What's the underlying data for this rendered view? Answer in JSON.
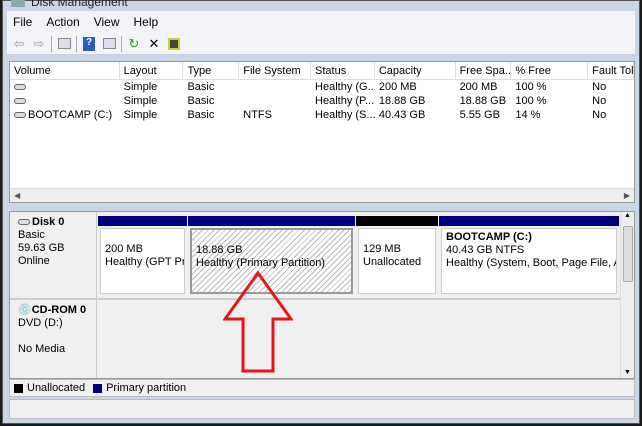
{
  "window": {
    "title": "Disk Management"
  },
  "menu": [
    "File",
    "Action",
    "View",
    "Help"
  ],
  "toolbar": [
    "back-icon",
    "forward-icon",
    "console-tree-icon",
    "help-icon",
    "action-pane-icon",
    "refresh-icon",
    "delete-icon",
    "properties-icon"
  ],
  "volumes": {
    "columns": [
      "Volume",
      "Layout",
      "Type",
      "File System",
      "Status",
      "Capacity",
      "Free Spa...",
      "% Free",
      "Fault Tole"
    ],
    "rows": [
      [
        "",
        "Simple",
        "Basic",
        "",
        "Healthy (G...",
        "200 MB",
        "200 MB",
        "100 %",
        "No"
      ],
      [
        "",
        "Simple",
        "Basic",
        "",
        "Healthy (P...",
        "18.88 GB",
        "18.88 GB",
        "100 %",
        "No"
      ],
      [
        "BOOTCAMP (C:)",
        "Simple",
        "Basic",
        "NTFS",
        "Healthy (S...",
        "40.43 GB",
        "5.55 GB",
        "14 %",
        "No"
      ]
    ]
  },
  "disks": [
    {
      "name": "Disk 0",
      "type": "Basic",
      "size": "59.63 GB",
      "state": "Online",
      "partitions": [
        {
          "title": "",
          "size": "200 MB",
          "status": "Healthy (GPT Pro",
          "kind": "primary"
        },
        {
          "title": "",
          "size": "18.88 GB",
          "status": "Healthy (Primary Partition)",
          "kind": "primary",
          "selected": true
        },
        {
          "title": "",
          "size": "129 MB",
          "status": "Unallocated",
          "kind": "unallocated"
        },
        {
          "title": "BOOTCAMP  (C:)",
          "size": "40.43 GB NTFS",
          "status": "Healthy (System, Boot, Page File, Activ",
          "kind": "primary"
        }
      ]
    },
    {
      "name": "CD-ROM 0",
      "type": "DVD (D:)",
      "state": "No Media"
    }
  ],
  "legend": [
    {
      "label": "Unallocated",
      "color": "#000000"
    },
    {
      "label": "Primary partition",
      "color": "#000080"
    }
  ],
  "colors": {
    "primary": "#000080",
    "unallocated": "#000000",
    "arrow": "#e8141c"
  }
}
